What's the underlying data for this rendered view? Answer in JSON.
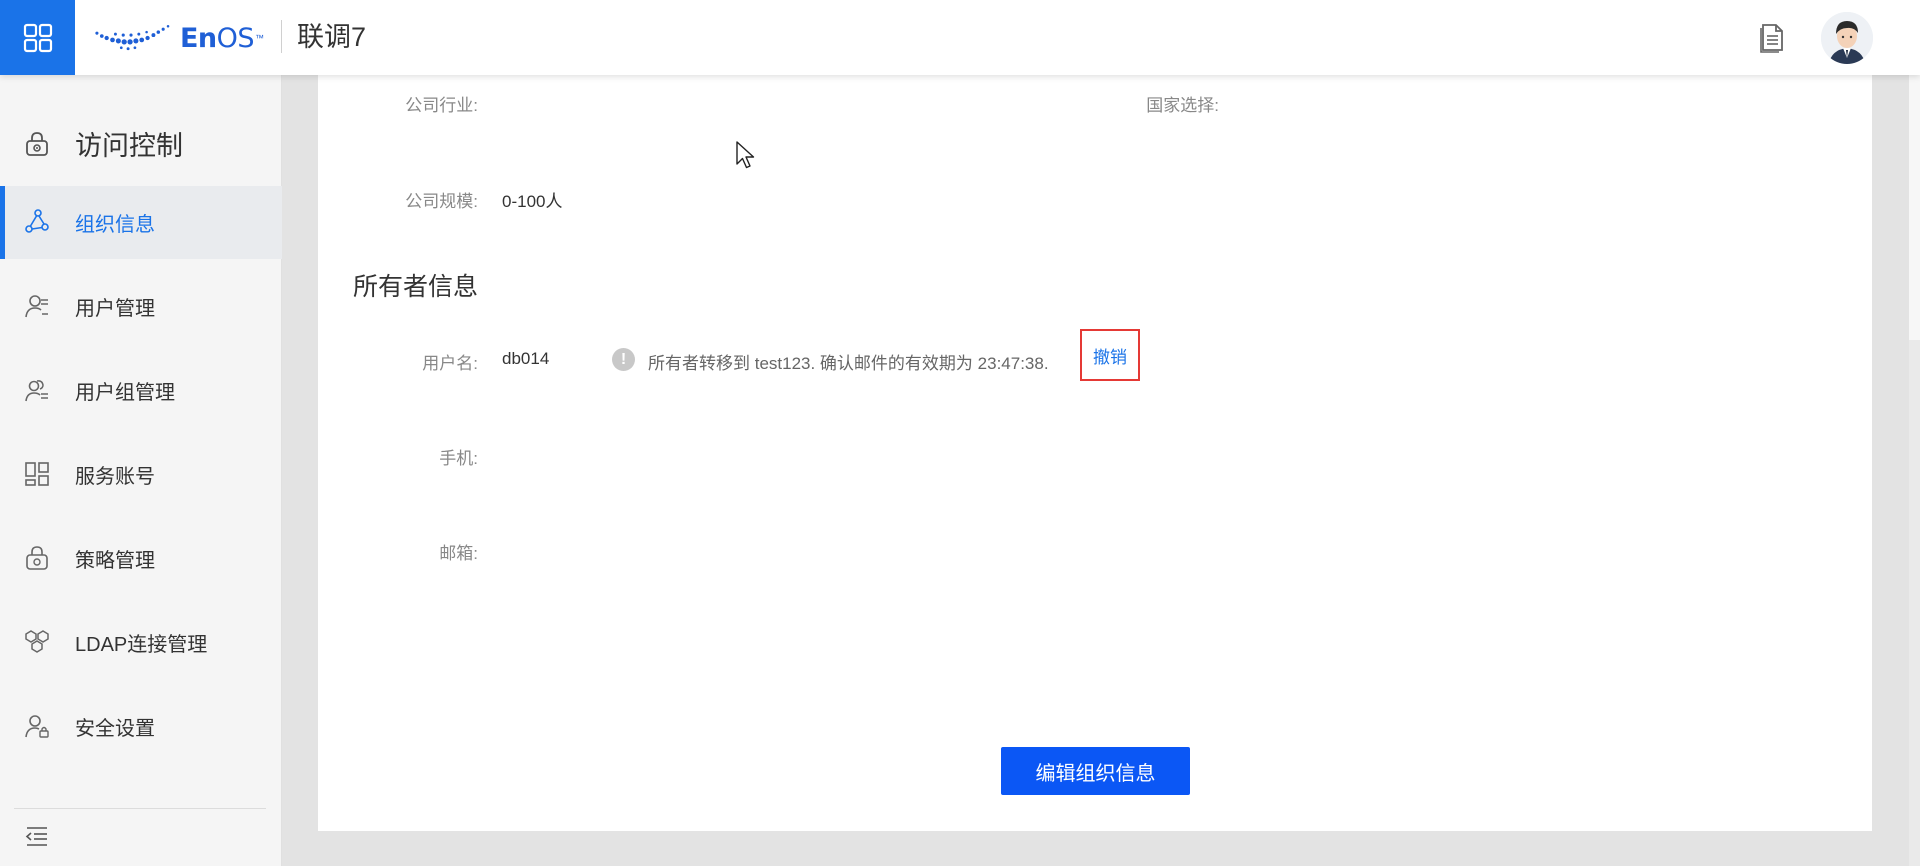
{
  "header": {
    "logo_text_en": "En",
    "logo_text_os": "OS",
    "logo_tm": "™",
    "org_name": "联调7",
    "icons": [
      "apps-grid-icon",
      "document-icon",
      "avatar"
    ]
  },
  "sidebar": {
    "title": "访问控制",
    "items": [
      {
        "label": "组织信息",
        "icon": "org-tree-icon",
        "active": true
      },
      {
        "label": "用户管理",
        "icon": "user-icon",
        "active": false
      },
      {
        "label": "用户组管理",
        "icon": "user-group-icon",
        "active": false
      },
      {
        "label": "服务账号",
        "icon": "service-grid-icon",
        "active": false
      },
      {
        "label": "策略管理",
        "icon": "policy-lock-icon",
        "active": false
      },
      {
        "label": "LDAP连接管理",
        "icon": "ldap-cubes-icon",
        "active": false
      },
      {
        "label": "安全设置",
        "icon": "user-security-icon",
        "active": false
      }
    ]
  },
  "company": {
    "industry_label": "公司行业:",
    "industry_value": "",
    "country_label": "国家选择:",
    "country_value": "",
    "size_label": "公司规模:",
    "size_value": "0-100人"
  },
  "owner": {
    "section_title": "所有者信息",
    "username_label": "用户名:",
    "username_value": "db014",
    "transfer_notice": "所有者转移到 test123. 确认邮件的有效期为 23:47:38.",
    "revoke_label": "撤销",
    "phone_label": "手机:",
    "phone_value": "",
    "email_label": "邮箱:",
    "email_value": ""
  },
  "actions": {
    "edit_label": "编辑组织信息"
  },
  "colors": {
    "accent": "#1a73e8",
    "primary_button": "#0b57f5",
    "highlight_border": "#e53935"
  }
}
